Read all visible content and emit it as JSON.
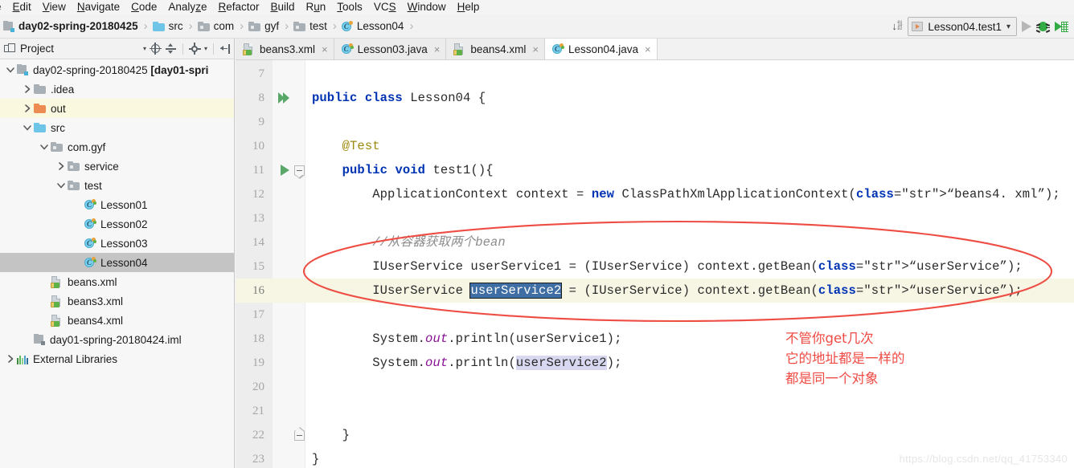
{
  "menu": {
    "items": [
      {
        "label": "e",
        "mnemonic": "",
        "clipped": true
      },
      {
        "label": "Edit",
        "mnemonic": "E"
      },
      {
        "label": "View",
        "mnemonic": "V"
      },
      {
        "label": "Navigate",
        "mnemonic": "N"
      },
      {
        "label": "Code",
        "mnemonic": "C"
      },
      {
        "label": "Analyze",
        "mnemonic": "z"
      },
      {
        "label": "Refactor",
        "mnemonic": "R"
      },
      {
        "label": "Build",
        "mnemonic": "B"
      },
      {
        "label": "Run",
        "mnemonic": "u"
      },
      {
        "label": "Tools",
        "mnemonic": "T"
      },
      {
        "label": "VCS",
        "mnemonic": "S"
      },
      {
        "label": "Window",
        "mnemonic": "W"
      },
      {
        "label": "Help",
        "mnemonic": "H"
      }
    ]
  },
  "breadcrumb": {
    "items": [
      {
        "label": "day02-spring-20180425",
        "icon": "module-icon",
        "bold": true
      },
      {
        "label": "src",
        "icon": "folder-cyan-icon",
        "bold": false
      },
      {
        "label": "com",
        "icon": "folder-package-icon",
        "bold": false
      },
      {
        "label": "gyf",
        "icon": "folder-package-icon",
        "bold": false
      },
      {
        "label": "test",
        "icon": "folder-package-icon",
        "bold": false
      },
      {
        "label": "Lesson04",
        "icon": "java-class-icon",
        "bold": false
      }
    ],
    "separator": "›"
  },
  "toolbar_right": {
    "updown_icon": "sort-toggle-icon",
    "run_config": {
      "label": "Lesson04.test1",
      "chevron": "˅",
      "icon": "run-config-icon"
    },
    "run_button": "run-button",
    "debug_button": "debug-button",
    "coverage_button": "run-with-coverage-button"
  },
  "project_panel": {
    "title": "Project",
    "tools": [
      "chevron-down-icon",
      "locate-target-icon",
      "collapse-all-icon",
      "gear-icon",
      "hide-panel-icon"
    ],
    "tree": [
      {
        "label": "day02-spring-20180425 ",
        "bold_suffix": "[day01-spri",
        "indent": 0,
        "twist": "down",
        "icon": "module-icon",
        "state": "normal"
      },
      {
        "label": ".idea",
        "indent": 1,
        "twist": "right",
        "icon": "folder-gray-icon",
        "state": "normal"
      },
      {
        "label": "out",
        "indent": 1,
        "twist": "right",
        "icon": "folder-orange-icon",
        "state": "highlight"
      },
      {
        "label": "src",
        "indent": 1,
        "twist": "down",
        "icon": "folder-cyan-icon",
        "state": "normal"
      },
      {
        "label": "com.gyf",
        "indent": 2,
        "twist": "down",
        "icon": "folder-package-icon",
        "state": "normal"
      },
      {
        "label": "service",
        "indent": 3,
        "twist": "right",
        "icon": "folder-package-icon",
        "state": "normal"
      },
      {
        "label": "test",
        "indent": 3,
        "twist": "down",
        "icon": "folder-package-icon",
        "state": "normal"
      },
      {
        "label": "Lesson01",
        "indent": 4,
        "twist": "none",
        "icon": "java-class-icon",
        "state": "normal"
      },
      {
        "label": "Lesson02",
        "indent": 4,
        "twist": "none",
        "icon": "java-class-icon",
        "state": "normal"
      },
      {
        "label": "Lesson03",
        "indent": 4,
        "twist": "none",
        "icon": "java-class-icon",
        "state": "normal"
      },
      {
        "label": "Lesson04",
        "indent": 4,
        "twist": "none",
        "icon": "java-class-icon",
        "state": "selected"
      },
      {
        "label": "beans.xml",
        "indent": 2,
        "twist": "none",
        "icon": "xml-icon",
        "state": "normal"
      },
      {
        "label": "beans3.xml",
        "indent": 2,
        "twist": "none",
        "icon": "xml-icon",
        "state": "normal"
      },
      {
        "label": "beans4.xml",
        "indent": 2,
        "twist": "none",
        "icon": "xml-icon",
        "state": "normal"
      },
      {
        "label": "day01-spring-20180424.iml",
        "indent": 1,
        "twist": "none",
        "icon": "module-file-icon",
        "state": "normal"
      },
      {
        "label": "External Libraries",
        "indent": 0,
        "twist": "right",
        "icon": "libraries-icon",
        "state": "normal"
      }
    ]
  },
  "editor": {
    "tabs": [
      {
        "label": "beans3.xml",
        "icon": "xml-icon",
        "active": false,
        "close": "×"
      },
      {
        "label": "Lesson03.java",
        "icon": "java-class-icon",
        "active": false,
        "close": "×"
      },
      {
        "label": "beans4.xml",
        "icon": "xml-icon",
        "active": false,
        "close": "×"
      },
      {
        "label": "Lesson04.java",
        "icon": "java-class-icon",
        "active": true,
        "close": "×"
      }
    ],
    "current_line": 16,
    "lines": [
      {
        "n": 7,
        "text": "",
        "gutter": ""
      },
      {
        "n": 8,
        "text": "public class Lesson04 {",
        "gutter": "run-all-icon"
      },
      {
        "n": 9,
        "text": "",
        "gutter": ""
      },
      {
        "n": 10,
        "text": "    @Test",
        "gutter": ""
      },
      {
        "n": 11,
        "text": "    public void test1(){",
        "gutter": "run-method-icon",
        "fold": "open-down"
      },
      {
        "n": 12,
        "text": "        ApplicationContext context = new ClassPathXmlApplicationContext(\"beans4. xml\");",
        "gutter": ""
      },
      {
        "n": 13,
        "text": "",
        "gutter": ""
      },
      {
        "n": 14,
        "text": "        //从容器获取两个bean",
        "gutter": ""
      },
      {
        "n": 15,
        "text": "        IUserService userService1 = (IUserService) context.getBean(\"userService\");",
        "gutter": ""
      },
      {
        "n": 16,
        "text": "        IUserService userService2 = (IUserService) context.getBean(\"userService\");",
        "gutter": ""
      },
      {
        "n": 17,
        "text": "",
        "gutter": ""
      },
      {
        "n": 18,
        "text": "        System.out.println(userService1);",
        "gutter": ""
      },
      {
        "n": 19,
        "text": "        System.out.println(userService2);",
        "gutter": ""
      },
      {
        "n": 20,
        "text": "",
        "gutter": ""
      },
      {
        "n": 21,
        "text": "",
        "gutter": ""
      },
      {
        "n": 22,
        "text": "    }",
        "gutter": "",
        "fold": "close-up"
      },
      {
        "n": 23,
        "text": "}",
        "gutter": ""
      }
    ],
    "selected_token": "userService2",
    "highlight_token": "userService2"
  },
  "annotations": {
    "ellipse_color": "#ee4d44",
    "note_lines": [
      "不管你get几次",
      "它的地址都是一样的",
      "都是同一个对象"
    ],
    "note_color": "#ef4b44"
  },
  "watermark": "https://blog.csdn.net/qq_41753340",
  "colors": {
    "keyword": "#0033b3",
    "string": "#067d17",
    "annotation": "#9e880d",
    "comment": "#8c8c8c",
    "static_field": "#871094",
    "selection": "#3f6ea5",
    "current_line_bg": "#f7f6e5",
    "tree_selected_bg": "#c4c4c4",
    "tree_highlight_bg": "#fbf8e0"
  }
}
